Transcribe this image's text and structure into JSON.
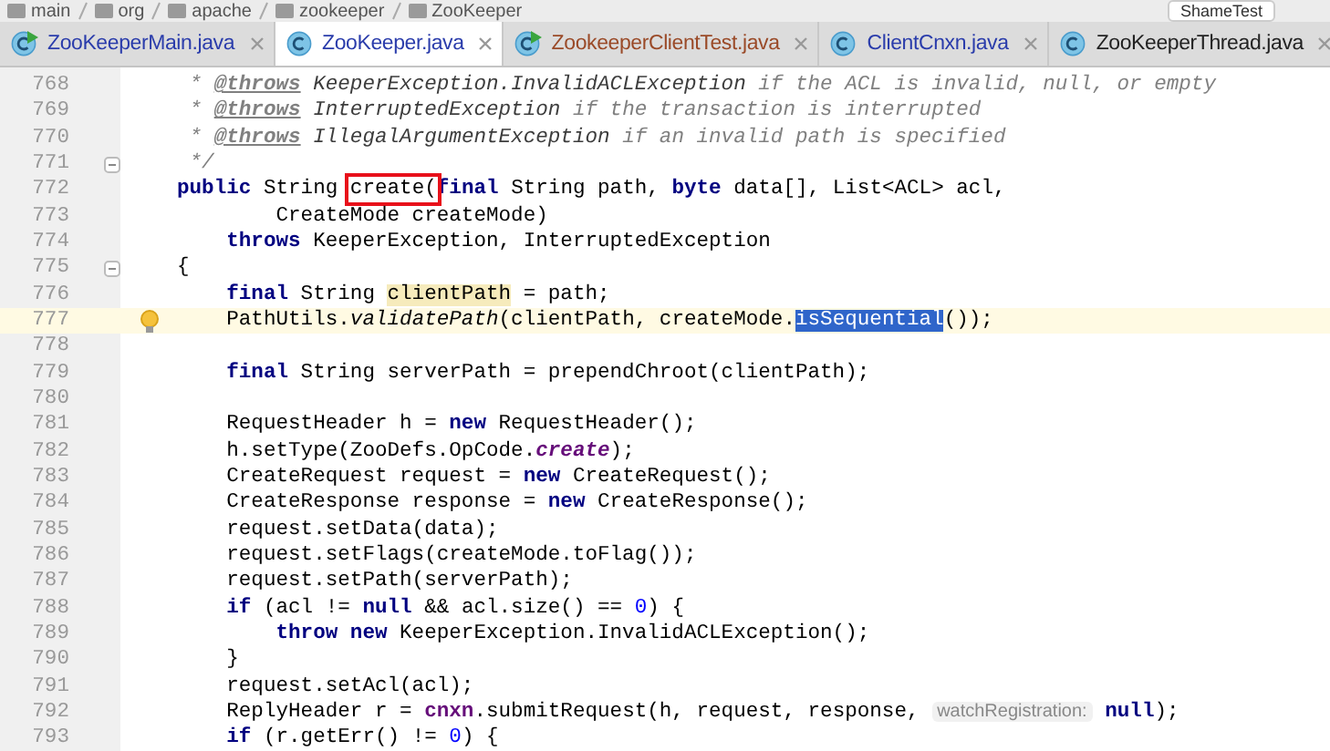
{
  "breadcrumb": {
    "items": [
      "main",
      "org",
      "apache",
      "zookeeper",
      "ZooKeeper"
    ],
    "run_config": "ShameTest"
  },
  "tabs": [
    {
      "label": "ZooKeeperMain.java",
      "selected": false,
      "runnable": true,
      "color": "#2a3cab"
    },
    {
      "label": "ZooKeeper.java",
      "selected": true,
      "runnable": false,
      "color": "#2a3cab"
    },
    {
      "label": "ZookeeperClientTest.java",
      "selected": false,
      "runnable": true,
      "color": "#9a4a28"
    },
    {
      "label": "ClientCnxn.java",
      "selected": false,
      "runnable": false,
      "color": "#2a3cab"
    },
    {
      "label": "ZooKeeperThread.java",
      "selected": false,
      "runnable": false,
      "color": "#222222"
    }
  ],
  "lines": [
    {
      "number": "768",
      "kind": "code",
      "current": false,
      "segments": [
        {
          "kind": "doc",
          "t": " * "
        },
        {
          "kind": "doctag",
          "t": "@throws"
        },
        {
          "kind": "docref",
          "t": " KeeperException.InvalidACLException"
        },
        {
          "kind": "doc",
          "t": " if the ACL is invalid, null, or empty"
        }
      ]
    },
    {
      "number": "769",
      "kind": "code",
      "current": false,
      "segments": [
        {
          "kind": "doc",
          "t": " * "
        },
        {
          "kind": "doctag",
          "t": "@throws"
        },
        {
          "kind": "docref",
          "t": " InterruptedException"
        },
        {
          "kind": "doc",
          "t": " if the transaction is interrupted"
        }
      ]
    },
    {
      "number": "770",
      "kind": "code",
      "current": false,
      "segments": [
        {
          "kind": "doc",
          "t": " * "
        },
        {
          "kind": "doctag",
          "t": "@throws"
        },
        {
          "kind": "docref",
          "t": " IllegalArgumentException"
        },
        {
          "kind": "doc",
          "t": " if an invalid path is specified"
        }
      ]
    },
    {
      "number": "771",
      "kind": "fold",
      "current": false,
      "segments": [
        {
          "kind": "doc",
          "t": " */"
        }
      ]
    },
    {
      "number": "772",
      "kind": "code",
      "current": false,
      "segments": [
        {
          "kind": "kw",
          "t": "public"
        },
        {
          "kind": "plain",
          "t": " String "
        },
        {
          "kind": "boxed",
          "t": "create("
        },
        {
          "kind": "kw",
          "t": "final"
        },
        {
          "kind": "plain",
          "t": " String path, "
        },
        {
          "kind": "kw",
          "t": "byte"
        },
        {
          "kind": "plain",
          "t": " data[], List<ACL> acl,"
        }
      ]
    },
    {
      "number": "773",
      "kind": "code",
      "current": false,
      "segments": [
        {
          "kind": "plain",
          "t": "        CreateMode createMode)"
        }
      ]
    },
    {
      "number": "774",
      "kind": "code",
      "current": false,
      "segments": [
        {
          "kind": "kw",
          "t": "    throws"
        },
        {
          "kind": "plain",
          "t": " KeeperException, InterruptedException"
        }
      ]
    },
    {
      "number": "775",
      "kind": "fold",
      "current": false,
      "segments": [
        {
          "kind": "plain",
          "t": "{"
        }
      ]
    },
    {
      "number": "776",
      "kind": "code",
      "current": false,
      "segments": [
        {
          "kind": "kw",
          "t": "    final"
        },
        {
          "kind": "plain",
          "t": " String "
        },
        {
          "kind": "hl",
          "t": "clientPath"
        },
        {
          "kind": "plain",
          "t": " = path;"
        }
      ]
    },
    {
      "number": "777",
      "kind": "bulb",
      "current": true,
      "segments": [
        {
          "kind": "plain",
          "t": "    PathUtils."
        },
        {
          "kind": "italic",
          "t": "validatePath"
        },
        {
          "kind": "plain",
          "t": "(clientPath, createMode."
        },
        {
          "kind": "sel",
          "t": "isSequential"
        },
        {
          "kind": "plain",
          "t": "());"
        }
      ]
    },
    {
      "number": "778",
      "kind": "code",
      "current": false
    },
    {
      "number": "779",
      "kind": "code",
      "current": false,
      "segments": [
        {
          "kind": "kw",
          "t": "    final"
        },
        {
          "kind": "plain",
          "t": " String serverPath = prependChroot(clientPath);"
        }
      ]
    },
    {
      "number": "780",
      "kind": "code",
      "current": false
    },
    {
      "number": "781",
      "kind": "code",
      "current": false,
      "segments": [
        {
          "kind": "plain",
          "t": "    RequestHeader h = "
        },
        {
          "kind": "kw",
          "t": "new"
        },
        {
          "kind": "plain",
          "t": " RequestHeader();"
        }
      ]
    },
    {
      "number": "782",
      "kind": "code",
      "current": false,
      "segments": [
        {
          "kind": "plain",
          "t": "    h.setType(ZooDefs.OpCode."
        },
        {
          "kind": "static",
          "t": "create"
        },
        {
          "kind": "plain",
          "t": ");"
        }
      ]
    },
    {
      "number": "783",
      "kind": "code",
      "current": false,
      "segments": [
        {
          "kind": "plain",
          "t": "    CreateRequest request = "
        },
        {
          "kind": "kw",
          "t": "new"
        },
        {
          "kind": "plain",
          "t": " CreateRequest();"
        }
      ]
    },
    {
      "number": "784",
      "kind": "code",
      "current": false,
      "segments": [
        {
          "kind": "plain",
          "t": "    CreateResponse response = "
        },
        {
          "kind": "kw",
          "t": "new"
        },
        {
          "kind": "plain",
          "t": " CreateResponse();"
        }
      ]
    },
    {
      "number": "785",
      "kind": "code",
      "current": false,
      "segments": [
        {
          "kind": "plain",
          "t": "    request.setData(data);"
        }
      ]
    },
    {
      "number": "786",
      "kind": "code",
      "current": false,
      "segments": [
        {
          "kind": "plain",
          "t": "    request.setFlags(createMode.toFlag());"
        }
      ]
    },
    {
      "number": "787",
      "kind": "code",
      "current": false,
      "segments": [
        {
          "kind": "plain",
          "t": "    request.setPath(serverPath);"
        }
      ]
    },
    {
      "number": "788",
      "kind": "code",
      "current": false,
      "segments": [
        {
          "kind": "kw",
          "t": "    if"
        },
        {
          "kind": "plain",
          "t": " (acl != "
        },
        {
          "kind": "kw",
          "t": "null"
        },
        {
          "kind": "plain",
          "t": " && acl.size() == "
        },
        {
          "kind": "num",
          "t": "0"
        },
        {
          "kind": "plain",
          "t": ") {"
        }
      ]
    },
    {
      "number": "789",
      "kind": "code",
      "current": false,
      "segments": [
        {
          "kind": "kw",
          "t": "        throw new"
        },
        {
          "kind": "plain",
          "t": " KeeperException.InvalidACLException();"
        }
      ]
    },
    {
      "number": "790",
      "kind": "code",
      "current": false,
      "segments": [
        {
          "kind": "plain",
          "t": "    }"
        }
      ]
    },
    {
      "number": "791",
      "kind": "code",
      "current": false,
      "segments": [
        {
          "kind": "plain",
          "t": "    request.setAcl(acl);"
        }
      ]
    },
    {
      "number": "792",
      "kind": "code",
      "current": false,
      "segments": [
        {
          "kind": "plain",
          "t": "    ReplyHeader r = "
        },
        {
          "kind": "field",
          "t": "cnxn"
        },
        {
          "kind": "plain",
          "t": ".submitRequest(h, request, response, "
        },
        {
          "kind": "hint",
          "t": "watchRegistration:"
        },
        {
          "kind": "kw",
          "t": " null"
        },
        {
          "kind": "plain",
          "t": ");"
        }
      ]
    },
    {
      "number": "793",
      "kind": "code",
      "current": false,
      "segments": [
        {
          "kind": "kw",
          "t": "    if"
        },
        {
          "kind": "plain",
          "t": " (r.getErr() != "
        },
        {
          "kind": "num",
          "t": "0"
        },
        {
          "kind": "plain",
          "t": ") {"
        }
      ]
    }
  ]
}
